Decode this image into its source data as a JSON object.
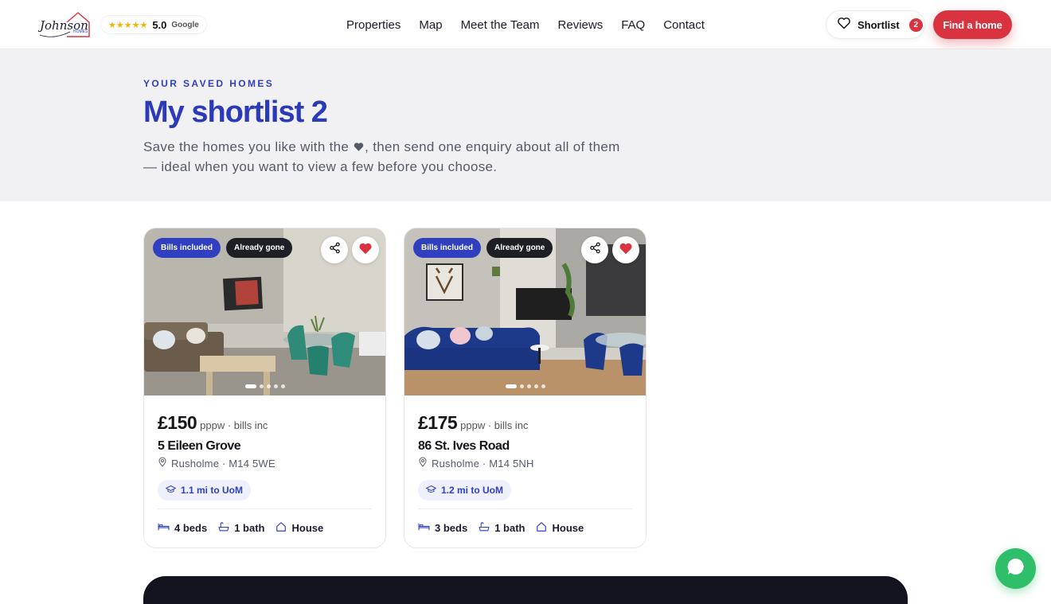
{
  "brand": {
    "logo_text": "Johnson",
    "logo_sub": "HOMES"
  },
  "rating": {
    "stars": "★★★★★",
    "score": "5.0",
    "source": "Google"
  },
  "nav": {
    "items": [
      {
        "label": "Properties"
      },
      {
        "label": "Map"
      },
      {
        "label": "Meet the Team"
      },
      {
        "label": "Reviews"
      },
      {
        "label": "FAQ"
      },
      {
        "label": "Contact"
      }
    ]
  },
  "header": {
    "shortlist_label": "Shortlist",
    "shortlist_count": "2",
    "find_label": "Find a home"
  },
  "hero": {
    "eyebrow": "YOUR SAVED HOMES",
    "title": "My shortlist 2",
    "subtitle_before": "Save the homes you like with the ",
    "subtitle_after": ", then send one enquiry about all of them — ideal when you want to view a few before you choose."
  },
  "colors": {
    "accent": "#2f3fbf",
    "brand_red": "#d9333f",
    "chat_green": "#2fbf6a"
  },
  "properties": [
    {
      "badge_bills": "Bills included",
      "badge_status": "Already gone",
      "price": "£150",
      "price_unit": "pppw · bills inc",
      "address": "5 Eileen Grove",
      "area": "Rusholme · M14 5WE",
      "distance": "1.1 mi to UoM",
      "beds": "4 beds",
      "baths": "1 bath",
      "type": "House"
    },
    {
      "badge_bills": "Bills included",
      "badge_status": "Already gone",
      "price": "£175",
      "price_unit": "pppw · bills inc",
      "address": "86 St. Ives Road",
      "area": "Rusholme · M14 5NH",
      "distance": "1.2 mi to UoM",
      "beds": "3 beds",
      "baths": "1 bath",
      "type": "House"
    }
  ]
}
